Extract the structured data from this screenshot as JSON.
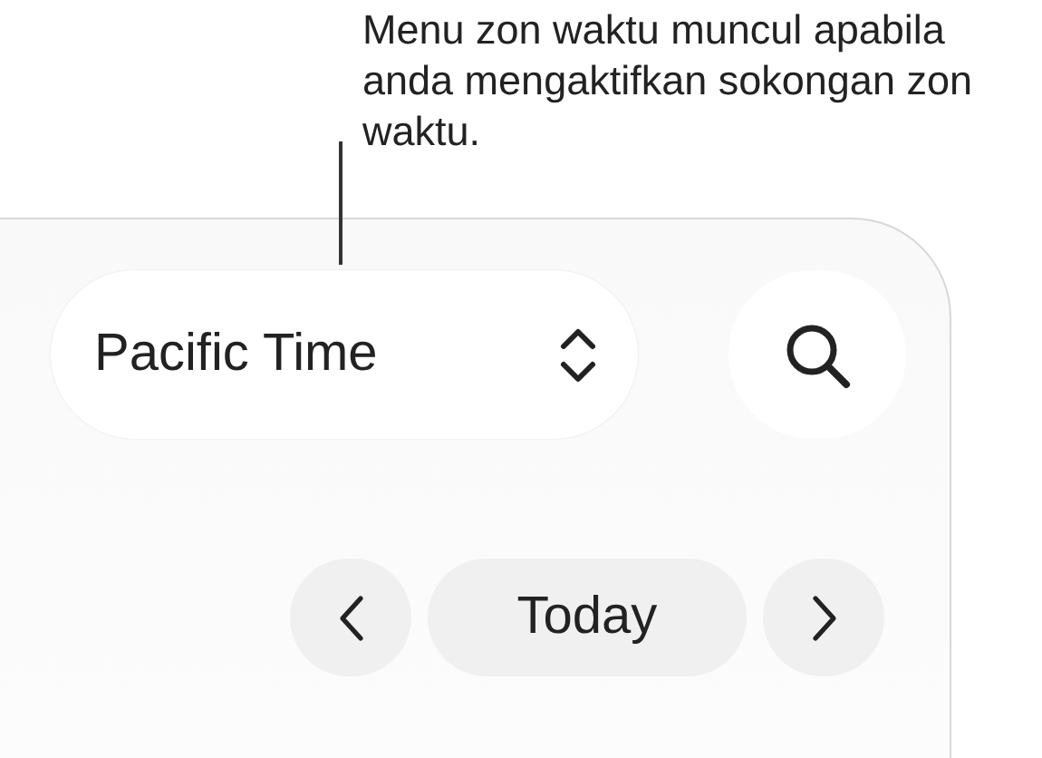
{
  "callout": {
    "text": "Menu zon waktu muncul apabila anda mengaktifkan sokongan zon waktu."
  },
  "toolbar": {
    "time_zone_menu": {
      "label": "Pacific Time"
    },
    "search_button": {
      "kind": "search"
    }
  },
  "navigation": {
    "today_button": {
      "label": "Today"
    }
  }
}
